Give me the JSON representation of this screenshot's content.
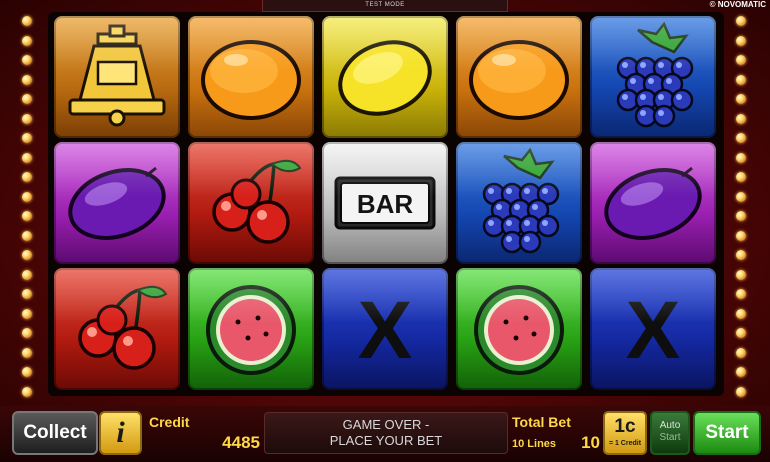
{
  "header": {
    "mode_text": "TEST MODE",
    "brand": "© NOVOMATIC"
  },
  "reels": [
    [
      {
        "symbol": "bell",
        "bg": "gold"
      },
      {
        "symbol": "plum",
        "bg": "purple"
      },
      {
        "symbol": "cherry",
        "bg": "red"
      }
    ],
    [
      {
        "symbol": "orange",
        "bg": "orange"
      },
      {
        "symbol": "cherry",
        "bg": "red"
      },
      {
        "symbol": "watermelon",
        "bg": "green"
      }
    ],
    [
      {
        "symbol": "lemon",
        "bg": "yellow"
      },
      {
        "symbol": "bar",
        "bg": "silver",
        "text": "BAR"
      },
      {
        "symbol": "x",
        "bg": "navy",
        "text": "X"
      }
    ],
    [
      {
        "symbol": "orange",
        "bg": "orange"
      },
      {
        "symbol": "grapes",
        "bg": "blue"
      },
      {
        "symbol": "watermelon",
        "bg": "green"
      }
    ],
    [
      {
        "symbol": "grapes",
        "bg": "blue"
      },
      {
        "symbol": "plum",
        "bg": "purple"
      },
      {
        "symbol": "x",
        "bg": "navy",
        "text": "X"
      }
    ]
  ],
  "controls": {
    "collect_label": "Collect",
    "info_label": "i",
    "credit_label": "Credit",
    "credit_value": "4485",
    "message_line1": "GAME OVER -",
    "message_line2": "PLACE YOUR BET",
    "total_bet_label": "Total Bet",
    "lines_label": "10 Lines",
    "total_bet_value": "10",
    "denomination": "1c",
    "denomination_sub": "= 1 Credit",
    "auto_label_line1": "Auto",
    "auto_label_line2": "Start",
    "start_label": "Start"
  },
  "colors": {
    "accent_gold": "#ffd84a",
    "frame_red": "#7a0e0e",
    "start_green": "#28a014"
  }
}
